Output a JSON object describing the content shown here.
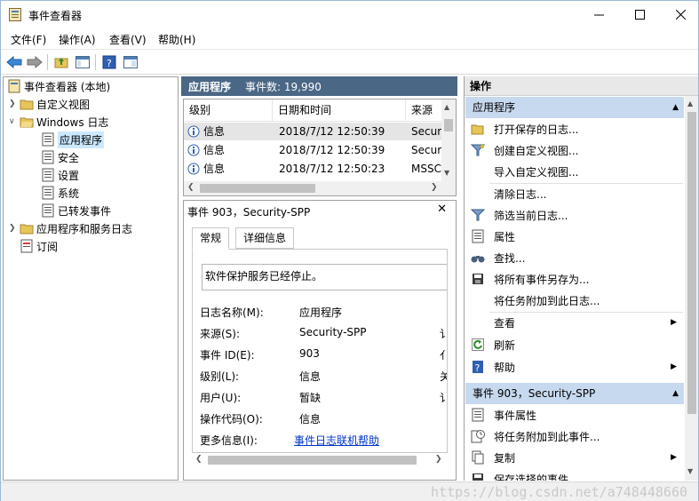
{
  "window": {
    "title": "事件查看器",
    "icon": "event-viewer-icon"
  },
  "menu": [
    "文件(F)",
    "操作(A)",
    "查看(V)",
    "帮助(H)"
  ],
  "tree": {
    "root": "事件查看器 (本地)",
    "custom_views": "自定义视图",
    "windows_logs": "Windows 日志",
    "logs": [
      "应用程序",
      "安全",
      "设置",
      "系统",
      "已转发事件"
    ],
    "app_service_logs": "应用程序和服务日志",
    "subscriptions": "订阅"
  },
  "center": {
    "title": "应用程序",
    "count_label": "事件数: 19,990",
    "columns": [
      "级别",
      "日期和时间",
      "来源"
    ],
    "rows": [
      {
        "level": "信息",
        "datetime": "2018/7/12 12:50:39",
        "source": "Secur"
      },
      {
        "level": "信息",
        "datetime": "2018/7/12 12:50:39",
        "source": "Secur"
      },
      {
        "level": "信息",
        "datetime": "2018/7/12 12:50:23",
        "source": "MSSC"
      }
    ]
  },
  "detail": {
    "title": "事件 903，Security-SPP",
    "tabs": [
      "常规",
      "详细信息"
    ],
    "description": "软件保护服务已经停止。",
    "fields": [
      {
        "label": "日志名称(M):",
        "value": "应用程序",
        "extra": ""
      },
      {
        "label": "来源(S):",
        "value": "Security-SPP",
        "extra": "讠"
      },
      {
        "label": "事件 ID(E):",
        "value": "903",
        "extra": "亻"
      },
      {
        "label": "级别(L):",
        "value": "信息",
        "extra": "关"
      },
      {
        "label": "用户(U):",
        "value": "暂缺",
        "extra": "讠"
      },
      {
        "label": "操作代码(O):",
        "value": "信息",
        "extra": ""
      },
      {
        "label": "更多信息(I):",
        "value": "事件日志联机帮助",
        "extra": ""
      }
    ]
  },
  "actions": {
    "header": "操作",
    "group1": "应用程序",
    "items1": [
      {
        "label": "打开保存的日志...",
        "icon": "folder-open-icon",
        "submenu": false
      },
      {
        "label": "创建自定义视图...",
        "icon": "filter-create-icon",
        "submenu": false
      },
      {
        "label": "导入自定义视图...",
        "icon": "",
        "submenu": false
      },
      {
        "label": "清除日志...",
        "icon": "",
        "submenu": false
      },
      {
        "label": "筛选当前日志...",
        "icon": "filter-icon",
        "submenu": false
      },
      {
        "label": "属性",
        "icon": "properties-icon",
        "submenu": false
      },
      {
        "label": "查找...",
        "icon": "binoculars-icon",
        "submenu": false
      },
      {
        "label": "将所有事件另存为...",
        "icon": "save-icon",
        "submenu": false
      },
      {
        "label": "将任务附加到此日志...",
        "icon": "",
        "submenu": false
      },
      {
        "label": "查看",
        "icon": "",
        "submenu": true
      },
      {
        "label": "刷新",
        "icon": "refresh-icon",
        "submenu": false
      },
      {
        "label": "帮助",
        "icon": "help-icon",
        "submenu": true
      }
    ],
    "group2": "事件 903，Security-SPP",
    "items2": [
      {
        "label": "事件属性",
        "icon": "event-properties-icon",
        "submenu": false
      },
      {
        "label": "将任务附加到此事件...",
        "icon": "task-icon",
        "submenu": false
      },
      {
        "label": "复制",
        "icon": "copy-icon",
        "submenu": true
      },
      {
        "label": "保存选择的事件...",
        "icon": "save-icon",
        "submenu": false
      }
    ]
  },
  "watermark": "https://blog.csdn.net/a748448660",
  "colors": {
    "center_header": "#4a6785",
    "group_header": "#c7d9ee",
    "selection": "#cce8ff",
    "link": "#0033cc"
  }
}
